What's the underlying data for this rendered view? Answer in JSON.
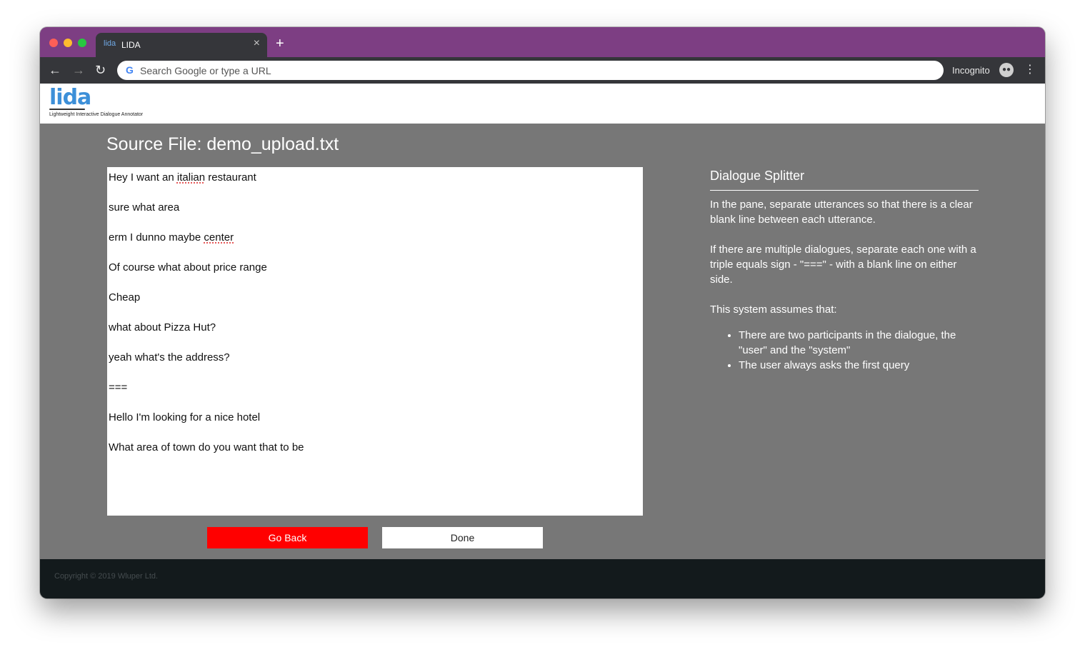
{
  "browser": {
    "tab": {
      "favicon_text": "lida",
      "title": "LIDA",
      "close_glyph": "×"
    },
    "new_tab_glyph": "+",
    "nav": {
      "back_glyph": "←",
      "forward_glyph": "→",
      "reload_glyph": "↻"
    },
    "omnibox": {
      "placeholder": "Search Google or type a URL",
      "value": ""
    },
    "incognito_label": "Incognito",
    "menu_glyph": "⋮",
    "icons": [
      "back-arrow-icon",
      "forward-arrow-icon",
      "reload-icon",
      "google-icon",
      "incognito-icon",
      "kebab-menu-icon",
      "close-icon",
      "plus-icon"
    ]
  },
  "app": {
    "logo": {
      "word": "lida",
      "tagline": "Lightweight Interactive Dialogue Annotator"
    },
    "source_file": "Source File: demo_upload.txt",
    "dialogue_lines": [
      "Hey I want an ",
      "italian",
      " restaurant\n\nsure what area\n\nerm I dunno maybe ",
      "center",
      "\n\nOf course what about price range\n\nCheap\n\nwhat about Pizza Hut?\n\nyeah what's the address?\n\n===\n\nHello I'm looking for a nice hotel\n\nWhat area of town do you want that to be"
    ],
    "buttons": {
      "go_back": "Go Back",
      "done": "Done"
    },
    "help": {
      "title": "Dialogue Splitter",
      "para1": "In the pane, separate utterances so that there is a clear blank line between each utterance.",
      "para2": "If there are multiple dialogues, separate each one with a triple equals sign - \"===\" - with a blank line on either side.",
      "para3": "This system assumes that:",
      "bullets": [
        "There are two participants in the dialogue, the \"user\" and the \"system\"",
        "The user always asks the first query"
      ]
    },
    "footer": {
      "copyright": "Copyright © 2019 Wluper Ltd."
    }
  },
  "colors": {
    "tab_strip": "#7d3e83",
    "toolbar": "#35363a",
    "page_background": "#777777",
    "go_back_button": "#ff0000",
    "footer": "#131a1c",
    "logo": "#3c8fd8"
  }
}
